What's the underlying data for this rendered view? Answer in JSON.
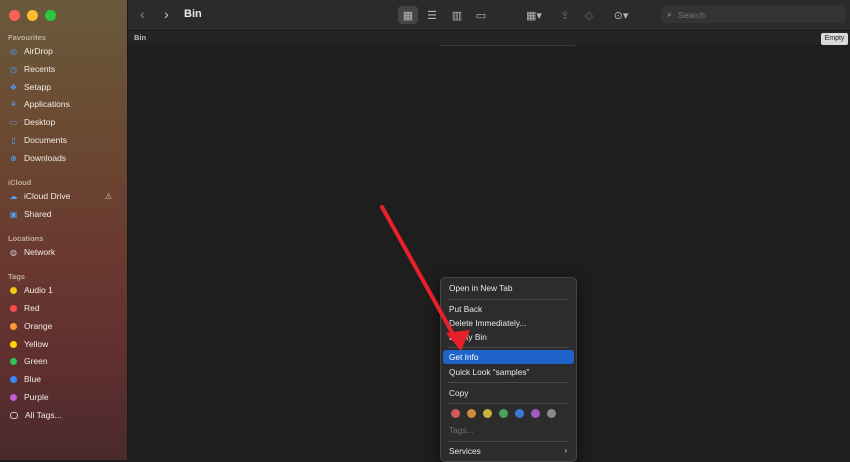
{
  "window": {
    "title": "Bin"
  },
  "toolbar": {
    "back_icon": "chevron-left-icon",
    "forward_icon": "chevron-right-icon",
    "views": [
      "grid-view-icon",
      "list-view-icon",
      "column-view-icon",
      "gallery-view-icon"
    ],
    "group_icon": "group-icon",
    "share_icon": "share-icon",
    "tag_icon": "tag-icon",
    "more_icon": "more-icon",
    "search": {
      "placeholder": "Search"
    }
  },
  "pathbar": {
    "label": "Bin",
    "empty_button": "Empty"
  },
  "sidebar": {
    "favourites_title": "Favourites",
    "favourites": [
      {
        "label": "AirDrop",
        "icon": "airdrop-icon"
      },
      {
        "label": "Recents",
        "icon": "clock-icon"
      },
      {
        "label": "Setapp",
        "icon": "setapp-icon"
      },
      {
        "label": "Applications",
        "icon": "applications-icon"
      },
      {
        "label": "Desktop",
        "icon": "desktop-icon"
      },
      {
        "label": "Documents",
        "icon": "document-icon"
      },
      {
        "label": "Downloads",
        "icon": "download-icon"
      }
    ],
    "icloud_title": "iCloud",
    "icloud": [
      {
        "label": "iCloud Drive",
        "icon": "cloud-icon"
      },
      {
        "label": "Shared",
        "icon": "shared-folder-icon"
      }
    ],
    "locations_title": "Locations",
    "locations": [
      {
        "label": "Network",
        "icon": "globe-icon"
      }
    ],
    "tags_title": "Tags",
    "tags": [
      {
        "label": "Audio 1",
        "color": "#f5c518"
      },
      {
        "label": "Red",
        "color": "#ff4b4b"
      },
      {
        "label": "Orange",
        "color": "#ff9a2e"
      },
      {
        "label": "Yellow",
        "color": "#ffd60a"
      },
      {
        "label": "Green",
        "color": "#30c45a"
      },
      {
        "label": "Blue",
        "color": "#3a86ff"
      },
      {
        "label": "Purple",
        "color": "#c45ad8"
      },
      {
        "label": "All Tags...",
        "color": ""
      }
    ]
  },
  "context_menu": {
    "open_new_tab": "Open in New Tab",
    "put_back": "Put Back",
    "delete_immediately": "Delete Immediately...",
    "empty_bin": "Empty Bin",
    "get_info": "Get Info",
    "quick_look": "Quick Look “samples”",
    "copy": "Copy",
    "tags": "Tags...",
    "services": "Services",
    "tag_colors": [
      "#d4595a",
      "#d08a3c",
      "#c9b33b",
      "#4aa35a",
      "#3a78d6",
      "#a05ac6",
      "#8a8a8a"
    ]
  },
  "annotation": {
    "arrow_color": "#e8202a"
  }
}
